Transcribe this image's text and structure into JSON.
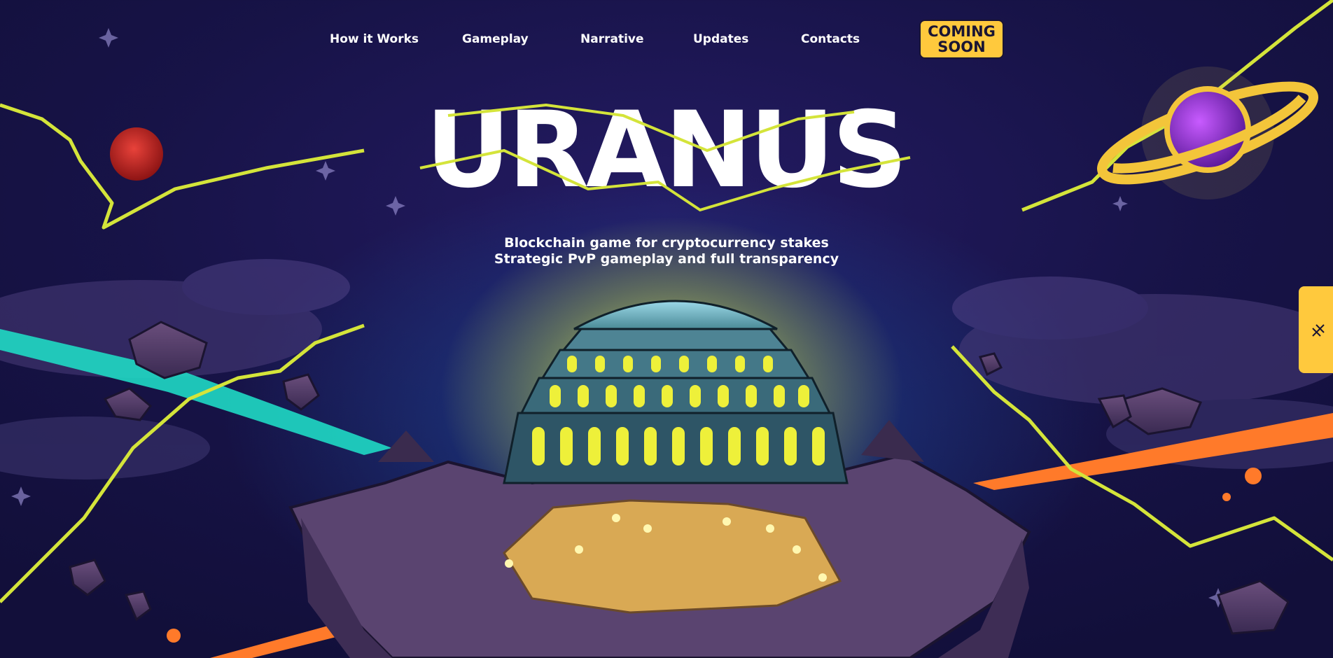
{
  "nav": {
    "items": [
      {
        "label": "How it Works"
      },
      {
        "label": "Gameplay"
      },
      {
        "label": "Narrative"
      },
      {
        "label": "Updates"
      },
      {
        "label": "Contacts"
      }
    ],
    "cta_line1": "COMING",
    "cta_line2": "SOON"
  },
  "hero": {
    "logo": "URANUS",
    "tagline_line1": "Blockchain game for cryptocurrency stakes",
    "tagline_line2": "Strategic PvP gameplay and full transparency"
  },
  "side_tab": {
    "icon": "close-icon"
  },
  "colors": {
    "accent": "#ffc93d",
    "background": "#171347",
    "lightning": "#d4e43a",
    "teal_streak": "#1fd9c4",
    "orange_streak": "#ff7a2a"
  }
}
